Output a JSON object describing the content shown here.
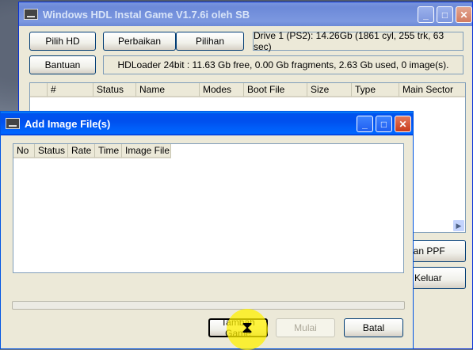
{
  "main_window": {
    "title": "Windows HDL Instal Game V1.7.6i oleh SB",
    "buttons": {
      "pilih_hd": "Pilih HD",
      "perbaikan": "Perbaikan",
      "pilihan": "Pilihan",
      "bantuan": "Bantuan",
      "hapus_ppf": "pkan PPF",
      "keluar": "Keluar"
    },
    "drive_info": "Drive 1 (PS2):  14.26Gb  (1861 cyl, 255 trk, 63 sec)",
    "hdloader_info": "HDLoader 24bit :  11.63 Gb free,  0.00 Gb fragments,  2.63 Gb used,  0 image(s).",
    "columns": [
      "",
      "#",
      "Status",
      "Name",
      "Modes",
      "Boot File",
      "Size",
      "Type",
      "Main Sector"
    ]
  },
  "dialog": {
    "title": "Add Image File(s)",
    "columns": [
      "No",
      "Status",
      "Rate",
      "Time",
      "Image File"
    ],
    "buttons": {
      "tambah_game": "Tambah Game",
      "mulai": "Mulai",
      "batal": "Batal"
    }
  },
  "icons": {
    "app": "hdd-app-icon",
    "minimize": "minimize-icon",
    "maximize": "maximize-icon",
    "close": "close-icon",
    "cursor": "hourglass-cursor-icon"
  }
}
